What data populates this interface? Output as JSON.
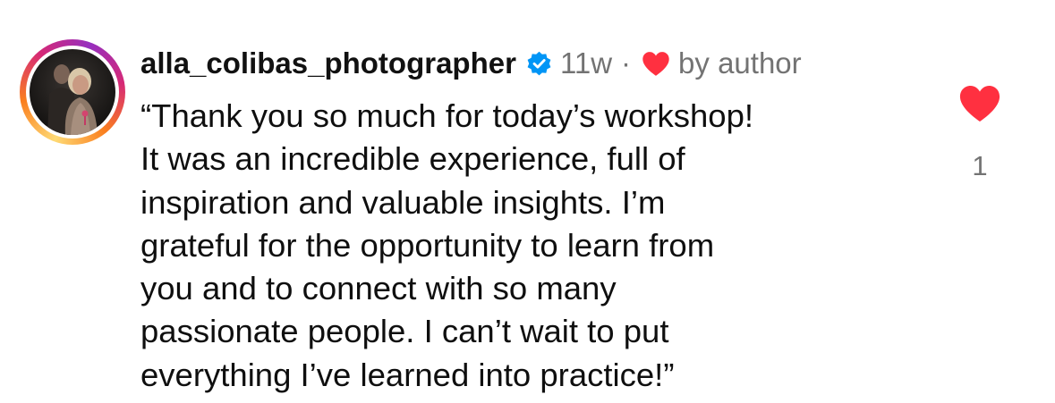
{
  "comment": {
    "username": "alla_colibas_photographer",
    "verified_icon": "verified-badge-icon",
    "time": "11w",
    "separator": "·",
    "liked_by_author_label": "by author",
    "text_lines": [
      "“Thank you so much for today’s workshop!",
      "It was an incredible experience, full of",
      "inspiration and valuable insights. I’m",
      "grateful for the opportunity to learn from",
      "you and to connect with so many",
      "passionate people. I can’t wait to put",
      "everything I’ve learned into practice!”"
    ],
    "like_count": "1"
  },
  "colors": {
    "heart_red": "#ff3040",
    "verified_blue": "#0095f6",
    "secondary_text": "#737373"
  }
}
